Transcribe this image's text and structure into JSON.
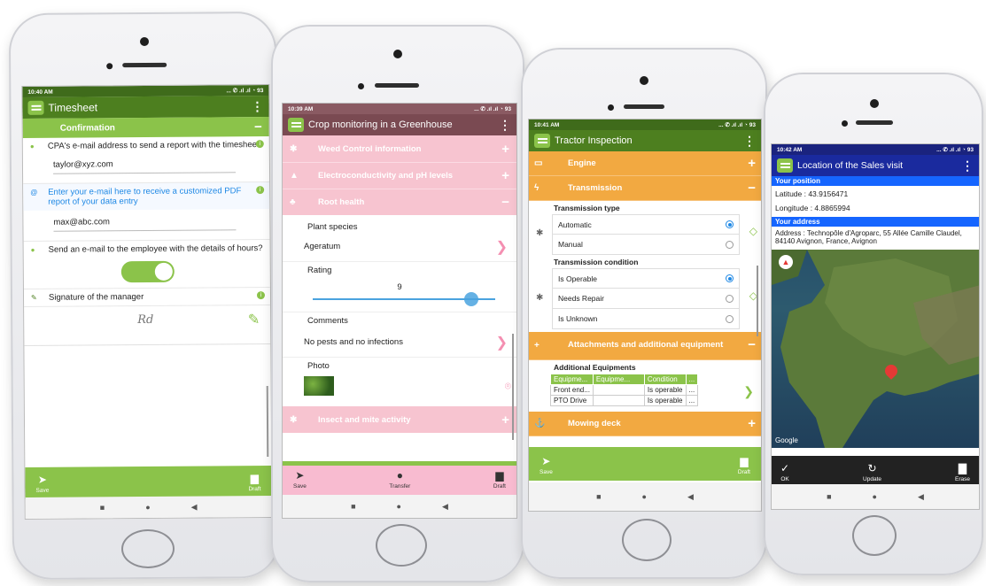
{
  "phone1": {
    "status_time": "10:40 AM",
    "status_icons": "... ✆ .ıl .ıl ◔ 93",
    "app_title": "Timesheet",
    "section_title": "Confirmation",
    "fields": [
      {
        "label": "CPA's e-mail address to send a report with the timesheet",
        "value": "taylor@xyz.com"
      },
      {
        "label": "Enter your e-mail here to receive a customized PDF report of your data entry",
        "value": "max@abc.com"
      },
      {
        "label": "Send an e-mail to the employee with the details of hours?"
      },
      {
        "label": "Signature of the manager"
      }
    ],
    "signature_text": "Rd",
    "bottom": {
      "save": "Save",
      "draft": "Draft"
    },
    "colors": {
      "statusbar": "#3f6b1b",
      "appbar": "#4d7f1f",
      "section": "#8bc34a",
      "accent_blue": "#1e88e5",
      "toggle": "#8bc34a"
    }
  },
  "phone2": {
    "status_time": "10:39 AM",
    "status_icons": "... ✆ .ıl .ıl ◔ 93",
    "app_title": "Crop monitoring in a Greenhouse",
    "sections": [
      "Weed Control information",
      "Electroconductivity and pH levels",
      "Root health"
    ],
    "plant_species_label": "Plant species",
    "plant_species_value": "Ageratum",
    "rating_label": "Rating",
    "rating_value": "9",
    "rating_fraction": 0.9,
    "comments_label": "Comments",
    "comments_value": "No pests and no infections",
    "photo_label": "Photo",
    "last_section": "Insect and mite activity",
    "bottom": {
      "save": "Save",
      "transfer": "Transfer",
      "draft": "Draft"
    },
    "colors": {
      "statusbar": "#8a5a62",
      "appbar": "#7a4a52",
      "section": "#f7c4d0",
      "active_section": "#f48fb1",
      "bottom": "#f8bbd0"
    }
  },
  "phone3": {
    "status_time": "10:41 AM",
    "status_icons": "... ✆ .ıl .ıl ◔ 93",
    "app_title": "Tractor Inspection",
    "sections": [
      "Engine",
      "Transmission"
    ],
    "transmission_type_label": "Transmission type",
    "transmission_type_options": [
      {
        "label": "Automatic",
        "selected": true
      },
      {
        "label": "Manual",
        "selected": false
      }
    ],
    "transmission_condition_label": "Transmission condition",
    "transmission_condition_options": [
      {
        "label": "Is Operable",
        "selected": true
      },
      {
        "label": "Needs Repair",
        "selected": false
      },
      {
        "label": "Is Unknown",
        "selected": false
      }
    ],
    "attachments_section": "Attachments and additional equipment",
    "additional_equipments_label": "Additional Equipments",
    "table_headers": [
      "Equipme...",
      "Equipme...",
      "Condition",
      "..."
    ],
    "table_rows": [
      [
        "Front end...",
        "",
        "Is operable",
        "..."
      ],
      [
        "PTO Drive",
        "",
        "Is operable",
        "..."
      ]
    ],
    "last_section": "Mowing deck",
    "bottom": {
      "save": "Save",
      "draft": "Draft"
    },
    "colors": {
      "statusbar": "#3f6b1b",
      "appbar": "#4d7f1f",
      "section": "#f2a941"
    }
  },
  "phone4": {
    "status_time": "10:42 AM",
    "status_icons": "... ✆ .ıl .ıl ◔ 93",
    "app_title": "Location of the Sales visit",
    "position_header": "Your position",
    "latitude": "Latitude : 43.9156471",
    "longitude": "Longitude : 4.8865994",
    "address_header": "Your address",
    "address": "Address : Technopôle d'Agroparc, 55 Allée Camille Claudel, 84140 Avignon, France, Avignon",
    "map_credit": "Google",
    "bottom": {
      "ok": "OK",
      "update": "Update",
      "erase": "Erase"
    },
    "colors": {
      "statusbar": "#1a237e",
      "appbar": "#1a2a9e",
      "header": "#1565ff",
      "bottom": "#222222",
      "pin": "#e53935"
    }
  }
}
